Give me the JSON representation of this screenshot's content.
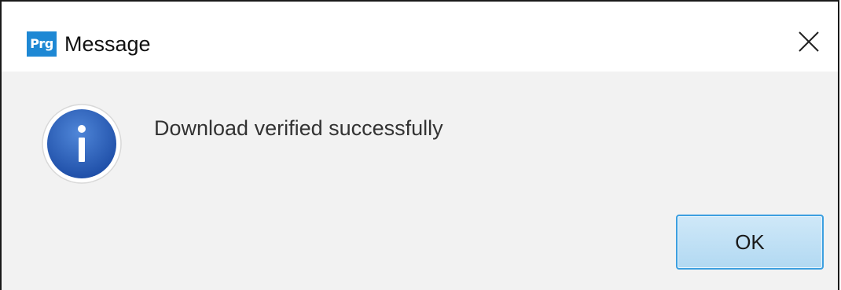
{
  "window": {
    "app_icon_text": "Prg",
    "title": "Message",
    "close_icon": "close-icon"
  },
  "content": {
    "icon": "info-icon",
    "message": "Download verified successfully"
  },
  "actions": {
    "ok_label": "OK"
  },
  "colors": {
    "accent": "#1e88d4",
    "info_icon": "#2f63b8",
    "button_border": "#3c9fe0",
    "dialog_bg": "#f2f2f2"
  }
}
